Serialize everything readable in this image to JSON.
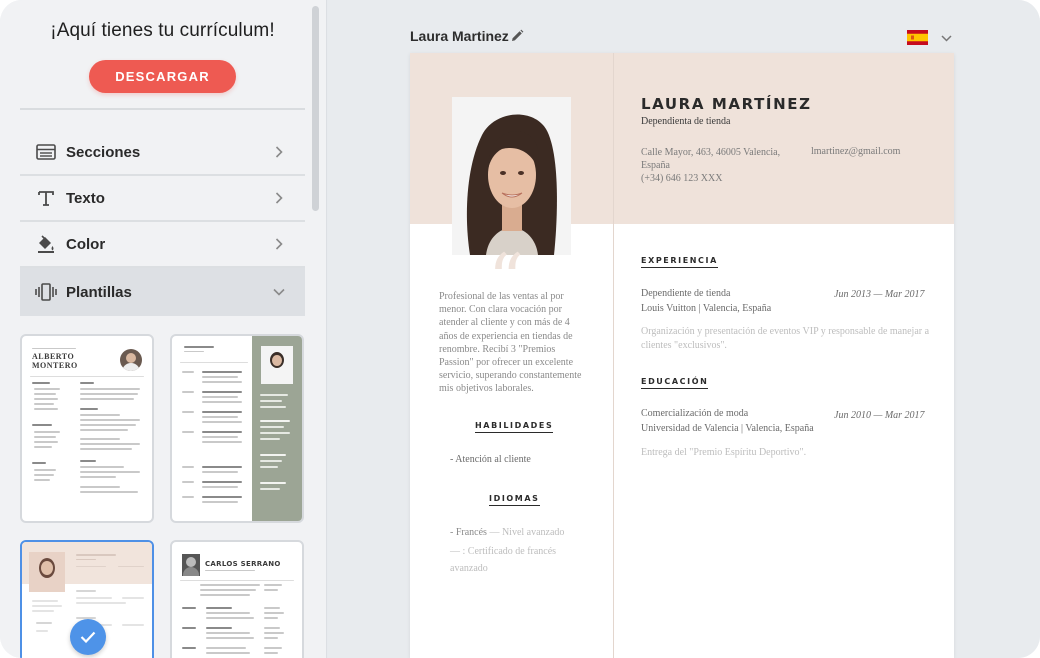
{
  "sidebar": {
    "title": "¡Aquí tienes tu currículum!",
    "download_label": "DESCARGAR",
    "menu": [
      {
        "label": "Secciones",
        "icon": "sections-icon"
      },
      {
        "label": "Texto",
        "icon": "text-icon"
      },
      {
        "label": "Color",
        "icon": "paint-bucket-icon"
      },
      {
        "label": "Plantillas",
        "icon": "templates-icon"
      }
    ],
    "templates": [
      {
        "name_line1": "ALBERTO",
        "name_line2": "MONTERO"
      },
      {
        "name_line1": "CARLOS SERRANO"
      }
    ]
  },
  "document": {
    "name": "Laura Martinez",
    "language_flag": "spain-flag-icon"
  },
  "resume": {
    "name": "LAURA MARTÍNEZ",
    "title": "Dependienta de tienda",
    "address": "Calle Mayor, 463, 46005 Valencia, España",
    "phone": "(+34) 646 123 XXX",
    "email": "lmartinez@gmail.com",
    "profile": "Profesional de las ventas al por menor. Con clara vocación por atender al cliente y con más de 4 años de experiencia en tiendas de renombre. Recibí 3 \"Premios Passion\" por ofrecer un excelente servicio, superando constantemente mis objetivos laborales.",
    "skills_heading": "HABILIDADES",
    "skills": [
      "- Atención al cliente"
    ],
    "languages_heading": "IDIOMAS",
    "language_1_name": "- Francés",
    "language_1_level": "— Nivel avanzado",
    "language_1_detail": "— : Certificado de francés avanzado",
    "experience_heading": "EXPERIENCIA",
    "experience": {
      "role": "Dependiente de tienda",
      "company": "Louis Vuitton | Valencia, España",
      "dates": "Jun 2013 — Mar 2017",
      "summary": "Organización y presentación de eventos VIP y responsable de manejar a clientes \"exclusivos\"."
    },
    "education_heading": "EDUCACIÓN",
    "education": {
      "degree": "Comercialización de moda",
      "school": "Universidad de Valencia | Valencia, España",
      "dates": "Jun 2010 — Mar 2017",
      "summary": "Entrega del \"Premio Espíritu Deportivo\"."
    }
  },
  "colors": {
    "accent": "#ee5a52",
    "header_bg": "#efe2da",
    "selected": "#4e90e6"
  }
}
